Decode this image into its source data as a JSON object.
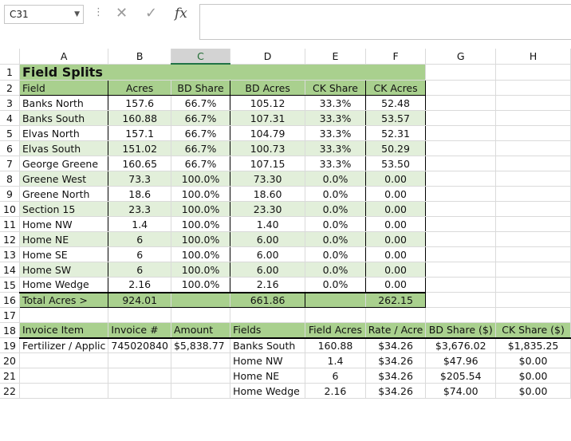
{
  "name_box": "C31",
  "formula_bar": {
    "cancel_icon": "✕",
    "enter_icon": "✓",
    "fx_label": "fx",
    "value": ""
  },
  "columns": [
    "A",
    "B",
    "C",
    "D",
    "E",
    "F",
    "G",
    "H"
  ],
  "row_numbers": [
    "1",
    "2",
    "3",
    "4",
    "5",
    "6",
    "7",
    "8",
    "9",
    "10",
    "11",
    "12",
    "13",
    "14",
    "15",
    "16",
    "17",
    "18",
    "19",
    "20",
    "21",
    "22"
  ],
  "field_splits": {
    "title": "Field Splits",
    "headers": [
      "Field",
      "Acres",
      "BD Share",
      "BD Acres",
      "CK Share",
      "CK Acres"
    ],
    "rows": [
      [
        "Banks North",
        "157.6",
        "66.7%",
        "105.12",
        "33.3%",
        "52.48"
      ],
      [
        "Banks South",
        "160.88",
        "66.7%",
        "107.31",
        "33.3%",
        "53.57"
      ],
      [
        "Elvas North",
        "157.1",
        "66.7%",
        "104.79",
        "33.3%",
        "52.31"
      ],
      [
        "Elvas South",
        "151.02",
        "66.7%",
        "100.73",
        "33.3%",
        "50.29"
      ],
      [
        "George Greene",
        "160.65",
        "66.7%",
        "107.15",
        "33.3%",
        "53.50"
      ],
      [
        "Greene West",
        "73.3",
        "100.0%",
        "73.30",
        "0.0%",
        "0.00"
      ],
      [
        "Greene North",
        "18.6",
        "100.0%",
        "18.60",
        "0.0%",
        "0.00"
      ],
      [
        "Section 15",
        "23.3",
        "100.0%",
        "23.30",
        "0.0%",
        "0.00"
      ],
      [
        "Home NW",
        "1.4",
        "100.0%",
        "1.40",
        "0.0%",
        "0.00"
      ],
      [
        "Home NE",
        "6",
        "100.0%",
        "6.00",
        "0.0%",
        "0.00"
      ],
      [
        "Home SE",
        "6",
        "100.0%",
        "6.00",
        "0.0%",
        "0.00"
      ],
      [
        "Home SW",
        "6",
        "100.0%",
        "6.00",
        "0.0%",
        "0.00"
      ],
      [
        "Home Wedge",
        "2.16",
        "100.0%",
        "2.16",
        "0.0%",
        "0.00"
      ]
    ],
    "total": {
      "label": "Total Acres >",
      "acres": "924.01",
      "bd_acres": "661.86",
      "ck_acres": "262.15"
    }
  },
  "invoice": {
    "headers": [
      "Invoice Item",
      "Invoice #",
      "Amount",
      "Fields",
      "Field Acres",
      "Rate / Acre",
      "BD Share ($)",
      "CK Share ($)"
    ],
    "rows": [
      [
        "Fertilizer / Applic",
        "745020840",
        "$5,838.77",
        "Banks South",
        "160.88",
        "$34.26",
        "$3,676.02",
        "$1,835.25"
      ],
      [
        "",
        "",
        "",
        "Home NW",
        "1.4",
        "$34.26",
        "$47.96",
        "$0.00"
      ],
      [
        "",
        "",
        "",
        "Home NE",
        "6",
        "$34.26",
        "$205.54",
        "$0.00"
      ],
      [
        "",
        "",
        "",
        "Home Wedge",
        "2.16",
        "$34.26",
        "$74.00",
        "$0.00"
      ]
    ]
  }
}
